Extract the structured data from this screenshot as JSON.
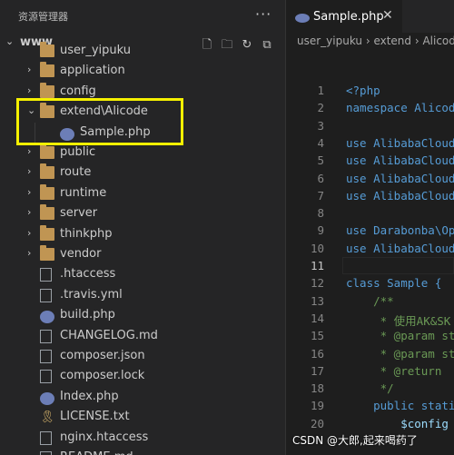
{
  "explorer": {
    "title": "资源管理器",
    "more": "···",
    "root": {
      "chevron": "⌄",
      "name": "www"
    },
    "actions": [
      "new-file-icon",
      "new-folder-icon",
      "refresh-icon",
      "collapse-all-icon"
    ],
    "items": [
      {
        "label": "user_yipuku",
        "type": "folder",
        "depth": 1,
        "chevron": ""
      },
      {
        "label": "application",
        "type": "folder",
        "depth": 1,
        "chevron": "›"
      },
      {
        "label": "config",
        "type": "folder",
        "depth": 1,
        "chevron": "›"
      },
      {
        "label": "extend\\Alicode",
        "type": "folder",
        "depth": 1,
        "chevron": "⌄"
      },
      {
        "label": "Sample.php",
        "type": "php",
        "depth": 2,
        "chevron": ""
      },
      {
        "label": "public",
        "type": "folder",
        "depth": 1,
        "chevron": "›"
      },
      {
        "label": "route",
        "type": "folder",
        "depth": 1,
        "chevron": "›"
      },
      {
        "label": "runtime",
        "type": "folder",
        "depth": 1,
        "chevron": "›"
      },
      {
        "label": "server",
        "type": "folder",
        "depth": 1,
        "chevron": "›"
      },
      {
        "label": "thinkphp",
        "type": "folder",
        "depth": 1,
        "chevron": "›"
      },
      {
        "label": "vendor",
        "type": "folder",
        "depth": 1,
        "chevron": "›"
      },
      {
        "label": ".htaccess",
        "type": "file",
        "depth": 1,
        "chevron": ""
      },
      {
        "label": ".travis.yml",
        "type": "file",
        "depth": 1,
        "chevron": ""
      },
      {
        "label": "build.php",
        "type": "php",
        "depth": 1,
        "chevron": ""
      },
      {
        "label": "CHANGELOG.md",
        "type": "file",
        "depth": 1,
        "chevron": ""
      },
      {
        "label": "composer.json",
        "type": "file",
        "depth": 1,
        "chevron": ""
      },
      {
        "label": "composer.lock",
        "type": "file",
        "depth": 1,
        "chevron": ""
      },
      {
        "label": "Index.php",
        "type": "php",
        "depth": 1,
        "chevron": ""
      },
      {
        "label": "LICENSE.txt",
        "type": "txt",
        "depth": 1,
        "chevron": ""
      },
      {
        "label": "nginx.htaccess",
        "type": "file",
        "depth": 1,
        "chevron": ""
      },
      {
        "label": "README.md",
        "type": "file",
        "depth": 1,
        "chevron": ""
      }
    ]
  },
  "editor": {
    "tab": {
      "label": "Sample.php",
      "close": "✕"
    },
    "breadcrumb": "user_yipuku › extend › Alicode",
    "active_line": 11,
    "lines": [
      {
        "n": "1",
        "text": "<?php",
        "color": "#569cd6"
      },
      {
        "n": "2",
        "text": "namespace Alicode;",
        "color": "#569cd6"
      },
      {
        "n": "3",
        "text": "",
        "color": "#d4d4d4"
      },
      {
        "n": "4",
        "text": "use AlibabaCloud\\",
        "color": "#569cd6"
      },
      {
        "n": "5",
        "text": "use AlibabaCloud\\",
        "color": "#569cd6"
      },
      {
        "n": "6",
        "text": "use AlibabaCloud\\",
        "color": "#569cd6"
      },
      {
        "n": "7",
        "text": "use AlibabaCloud\\",
        "color": "#569cd6"
      },
      {
        "n": "8",
        "text": "",
        "color": "#d4d4d4"
      },
      {
        "n": "9",
        "text": "use Darabonba\\Ope",
        "color": "#569cd6"
      },
      {
        "n": "10",
        "text": "use AlibabaCloud\\",
        "color": "#569cd6"
      },
      {
        "n": "11",
        "text": "",
        "color": "#d4d4d4"
      },
      {
        "n": "12",
        "text": "class Sample {",
        "color": "#569cd6"
      },
      {
        "n": "13",
        "text": "    /**",
        "color": "#6a9955"
      },
      {
        "n": "14",
        "text": "     * 使用AK&SK",
        "color": "#6a9955"
      },
      {
        "n": "15",
        "text": "     * @param st",
        "color": "#6a9955"
      },
      {
        "n": "16",
        "text": "     * @param st",
        "color": "#6a9955"
      },
      {
        "n": "17",
        "text": "     * @return",
        "color": "#6a9955"
      },
      {
        "n": "18",
        "text": "     */",
        "color": "#6a9955"
      },
      {
        "n": "19",
        "text": "    public stati",
        "color": "#569cd6"
      },
      {
        "n": "20",
        "text": "        $config",
        "color": "#9cdcfe"
      }
    ]
  },
  "watermark": "CSDN @大郎,起来喝药了"
}
